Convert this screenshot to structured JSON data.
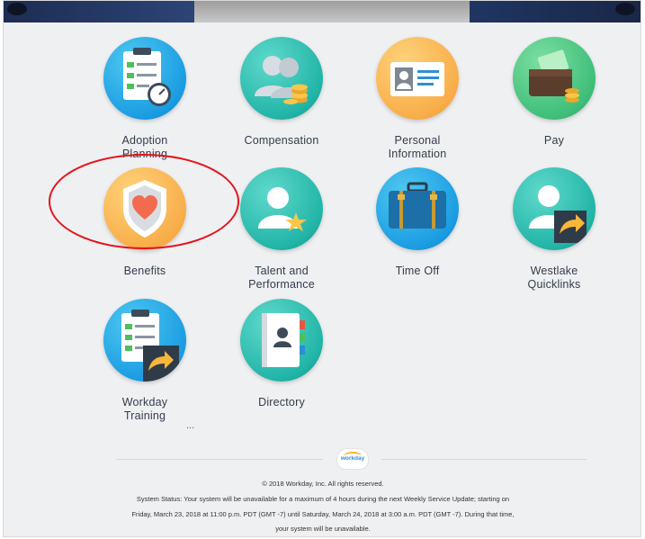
{
  "apps": [
    {
      "name": "adoption-planning",
      "label_lines": [
        "Adoption",
        "Planning"
      ],
      "icon": "clipboard-gauge-icon",
      "color": "blue"
    },
    {
      "name": "compensation",
      "label_lines": [
        "Compensation"
      ],
      "icon": "people-coins-icon",
      "color": "teal"
    },
    {
      "name": "personal-information",
      "label_lines": [
        "Personal",
        "Information"
      ],
      "icon": "id-card-icon",
      "color": "orange"
    },
    {
      "name": "pay",
      "label_lines": [
        "Pay"
      ],
      "icon": "wallet-icon",
      "color": "green"
    },
    {
      "name": "benefits",
      "label_lines": [
        "Benefits"
      ],
      "icon": "heart-shield-icon",
      "color": "orange"
    },
    {
      "name": "talent-and-performance",
      "label_lines": [
        "Talent and",
        "Performance"
      ],
      "icon": "person-star-icon",
      "color": "teal"
    },
    {
      "name": "time-off",
      "label_lines": [
        "Time Off"
      ],
      "icon": "suitcase-icon",
      "color": "blue"
    },
    {
      "name": "westlake-quicklinks",
      "label_lines": [
        "Westlake",
        "Quicklinks"
      ],
      "icon": "person-arrow-icon",
      "color": "teal"
    },
    {
      "name": "workday-training",
      "label_lines": [
        "Workday",
        "Training"
      ],
      "icon": "clipboard-arrow-icon",
      "color": "blue"
    },
    {
      "name": "directory",
      "label_lines": [
        "Directory"
      ],
      "icon": "address-book-icon",
      "color": "teal"
    }
  ],
  "more_indicator": "...",
  "logo_text": "workday",
  "footer": {
    "copyright": "© 2018 Workday, Inc. All rights reserved.",
    "status_line1": "System Status: Your system will be unavailable for a maximum of 4 hours during the next Weekly Service Update; starting on",
    "status_line2": "Friday, March 23, 2018 at 11:00 p.m. PDT (GMT -7) until Saturday, March 24, 2018 at 3:00 a.m. PDT (GMT -7). During that time,",
    "status_line3": "your system will be unavailable."
  },
  "colors": {
    "highlight_ring": "#e3141b",
    "label_text": "#333c49"
  }
}
